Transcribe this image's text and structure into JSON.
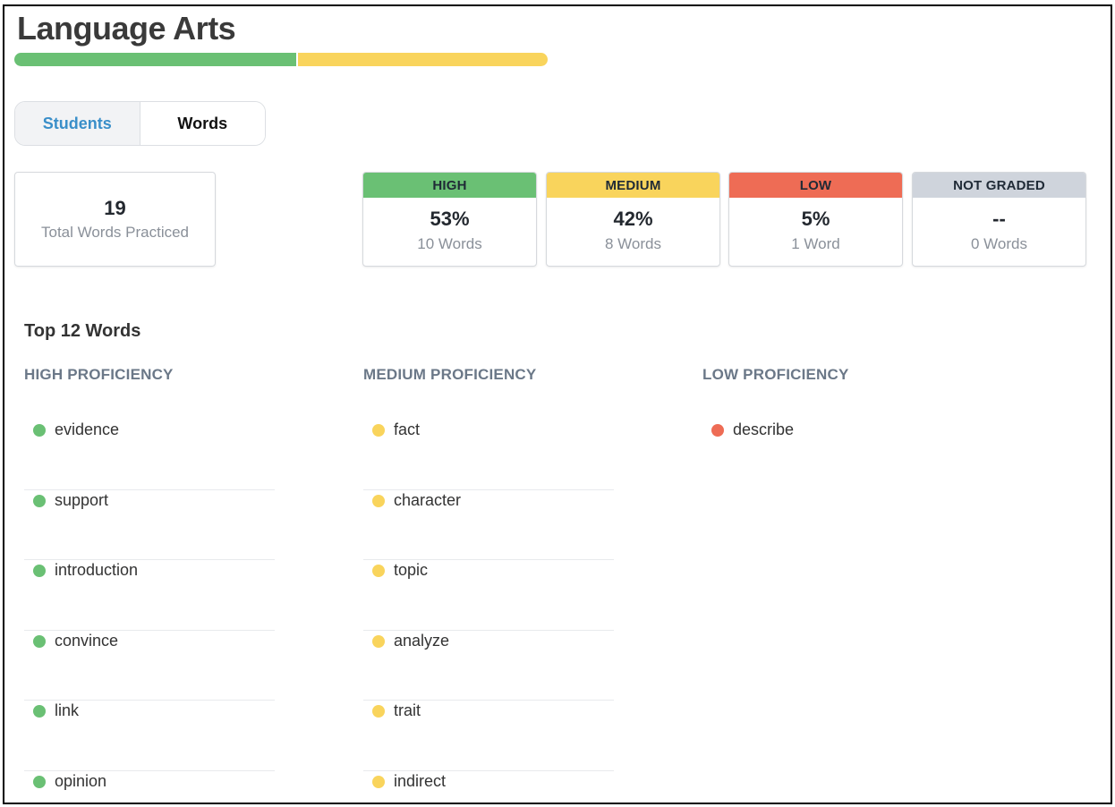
{
  "colors": {
    "high": "#6ac074",
    "medium": "#f9d45c",
    "low": "#ee6c55",
    "not_graded": "#cfd4dc"
  },
  "page": {
    "title": "Language Arts"
  },
  "progress": {
    "high_fraction": 0.53,
    "medium_fraction": 0.47
  },
  "tabs": [
    {
      "label": "Students",
      "active": true
    },
    {
      "label": "Words",
      "active": false
    }
  ],
  "total": {
    "value": "19",
    "label": "Total Words Practiced"
  },
  "stats": [
    {
      "label": "HIGH",
      "pct": "53%",
      "count": "10 Words",
      "color": "#6ac074"
    },
    {
      "label": "MEDIUM",
      "pct": "42%",
      "count": "8 Words",
      "color": "#f9d45c"
    },
    {
      "label": "LOW",
      "pct": "5%",
      "count": "1 Word",
      "color": "#ee6c55"
    },
    {
      "label": "NOT GRADED",
      "pct": "--",
      "count": "0 Words",
      "color": "#cfd4dc"
    }
  ],
  "top_words": {
    "title": "Top 12 Words",
    "columns": [
      {
        "heading": "HIGH PROFICIENCY",
        "color": "#6ac074",
        "words": [
          "evidence",
          "support",
          "introduction",
          "convince",
          "link",
          "opinion"
        ]
      },
      {
        "heading": "MEDIUM PROFICIENCY",
        "color": "#f9d45c",
        "words": [
          "fact",
          "character",
          "topic",
          "analyze",
          "trait",
          "indirect"
        ]
      },
      {
        "heading": "LOW PROFICIENCY",
        "color": "#ee6c55",
        "words": [
          "describe"
        ]
      }
    ]
  }
}
